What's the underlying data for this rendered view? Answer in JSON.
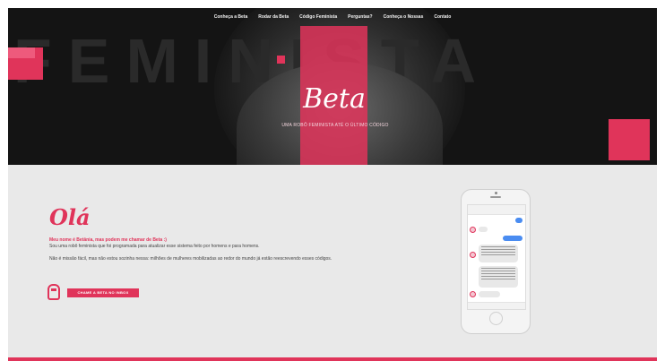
{
  "nav": {
    "items": [
      "Conheça a Beta",
      "Rodar da Beta",
      "Código Feminista",
      "Perguntas?",
      "Conheça o Nossas",
      "Contato"
    ]
  },
  "hero": {
    "big_word": "FEMINISTA",
    "logo": "Beta",
    "tagline": "UMA ROBÔ FEMINISTA ATÉ O ÚLTIMO CÓDIGO"
  },
  "content": {
    "greeting": "Olá",
    "intro_highlight": "Meu nome é Betânia, mas podem me chamar de Beta :)",
    "intro_text": "Sou uma robô feminista que foi programada para atualizar esse sistema feito por homens e para homens.",
    "body_text": "Não é missão fácil, mas não estou sozinha nessa: milhões de mulheres mobilizadas ao redor do mundo já estão reescrevendo esses códigos.",
    "cta_label": "CHAME A BETA NO INBOX"
  },
  "colors": {
    "accent": "#e0345a",
    "hero_bg": "#141414",
    "page_bg": "#e9e9e9"
  },
  "icons": [
    "beta-head-icon",
    "messenger-avatar-icon"
  ]
}
